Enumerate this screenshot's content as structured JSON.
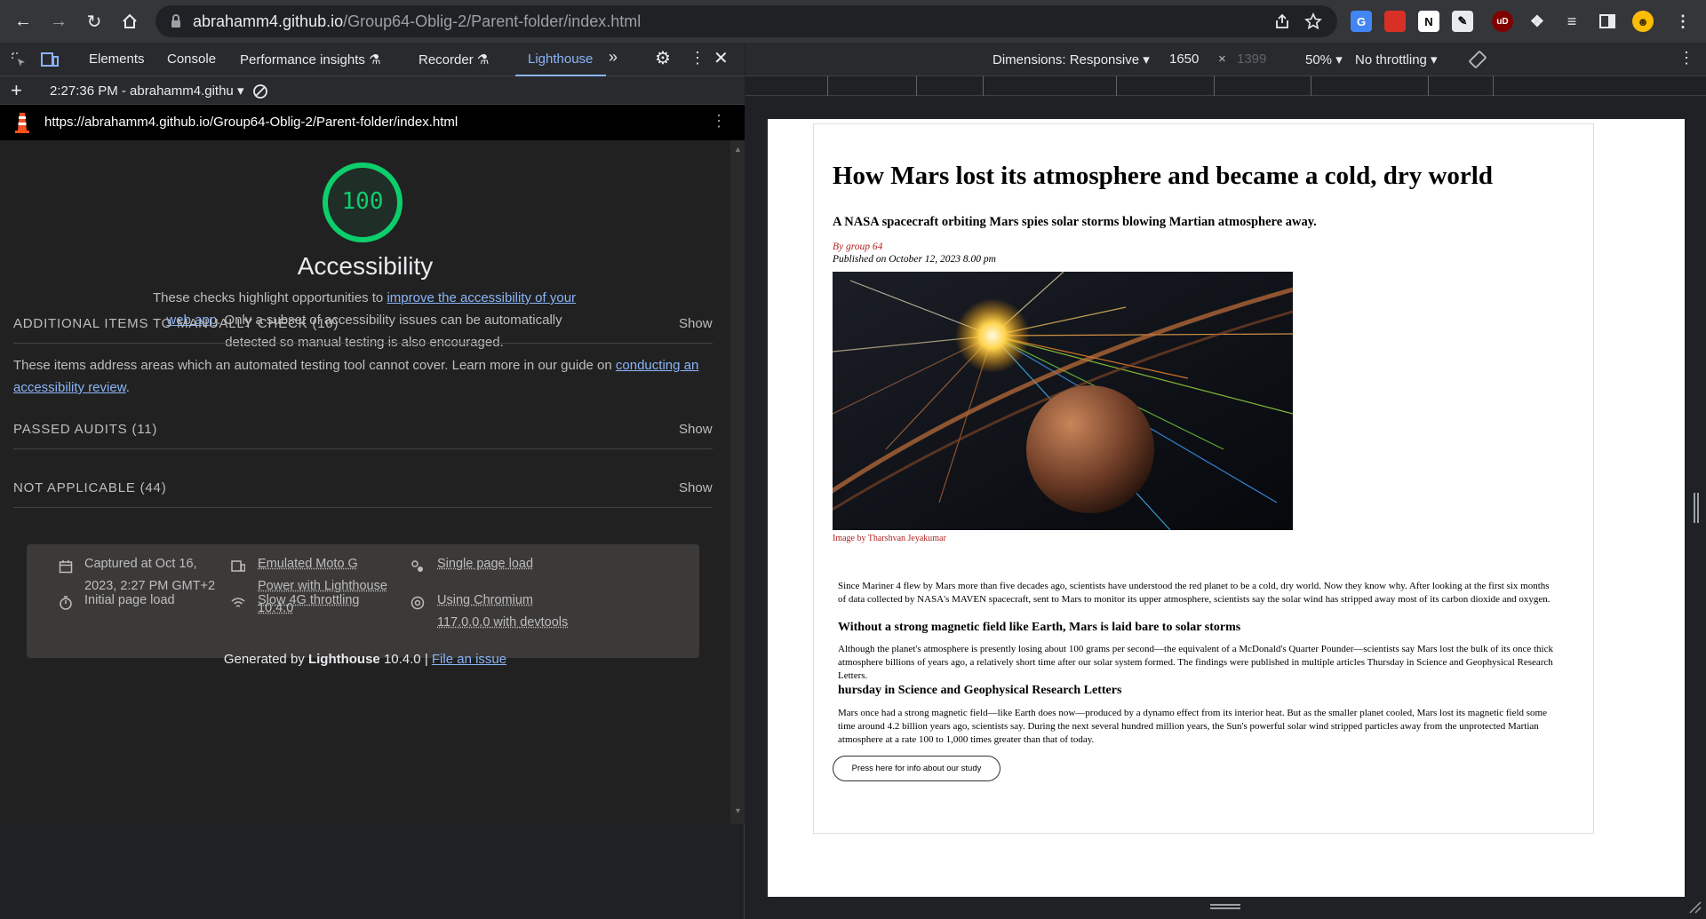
{
  "browser": {
    "url_host": "abrahamm4.github.io",
    "url_path": "/Group64-Oblig-2/Parent-folder/index.html"
  },
  "devtools": {
    "tabs": [
      "Elements",
      "Console",
      "Performance insights",
      "Recorder",
      "Lighthouse"
    ],
    "active_tab": "Lighthouse",
    "report_selector": "2:27:36 PM - abrahamm4.githu",
    "report_url": "https://abrahamm4.github.io/Group64-Oblig-2/Parent-folder/index.html"
  },
  "lighthouse": {
    "score": "100",
    "category": "Accessibility",
    "desc_prefix": "These checks highlight opportunities to ",
    "desc_link": "improve the accessibility of your web app",
    "desc_suffix": ". Only a subset of accessibility issues can be automatically detected so manual testing is also encouraged.",
    "groups": [
      {
        "title": "ADDITIONAL ITEMS TO MANUALLY CHECK (10)",
        "action": "Show"
      },
      {
        "title": "PASSED AUDITS (11)",
        "action": "Show"
      },
      {
        "title": "NOT APPLICABLE (44)",
        "action": "Show"
      }
    ],
    "manual_desc_prefix": "These items address areas which an automated testing tool cannot cover. Learn more in our guide on ",
    "manual_desc_link": "conducting an accessibility review",
    "manual_desc_suffix": ".",
    "runtime": {
      "captured": "Captured at Oct 16, 2023, 2:27 PM GMT+2",
      "initial": "Initial page load",
      "device": "Emulated Moto G Power with Lighthouse 10.4.0",
      "throttling": "Slow 4G throttling",
      "load": "Single page load",
      "browser": "Using Chromium 117.0.0.0 with devtools"
    },
    "footer_prefix": "Generated by ",
    "footer_brand": "Lighthouse",
    "footer_version": " 10.4.0 | ",
    "footer_link": "File an issue"
  },
  "device_toolbar": {
    "dimensions": "Dimensions: Responsive",
    "width": "1650",
    "height": "1399",
    "zoom": "50%",
    "throttling": "No throttling"
  },
  "article": {
    "title": "How Mars lost its atmosphere and became a cold, dry world",
    "subtitle": "A NASA spacecraft orbiting Mars spies solar storms blowing Martian atmosphere away.",
    "byline": "By group 64",
    "published": "Published on October 12, 2023 8.00 pm",
    "image_credit": "Image by Tharshvan Jeyakumar",
    "para1": "Since Mariner 4 flew by Mars more than five decades ago, scientists have understood the red planet to be a cold, dry world. Now they know why. After looking at the first six months of data collected by NASA's MAVEN spacecraft, sent to Mars to monitor its upper atmosphere, scientists say the solar wind has stripped away most of its carbon dioxide and oxygen.",
    "h2_1": "Without a strong magnetic field like Earth, Mars is laid bare to solar storms",
    "para2": "Although the planet's atmosphere is presently losing about 100 grams per second—the equivalent of a McDonald's Quarter Pounder—scientists say Mars lost the bulk of its once thick atmosphere billions of years ago, a relatively short time after our solar system formed. The findings were published in multiple articles Thursday in Science and Geophysical Research Letters.",
    "h2_2": "hursday in Science and Geophysical Research Letters",
    "para3": "Mars once had a strong magnetic field—like Earth does now—produced by a dynamo effect from its interior heat. But as the smaller planet cooled, Mars lost its magnetic field some time around 4.2 billion years ago, scientists say. During the next several hundred million years, the Sun's powerful solar wind stripped particles away from the unprotected Martian atmosphere at a rate 100 to 1,000 times greater than that of today.",
    "button": "Press here for info about our study"
  }
}
